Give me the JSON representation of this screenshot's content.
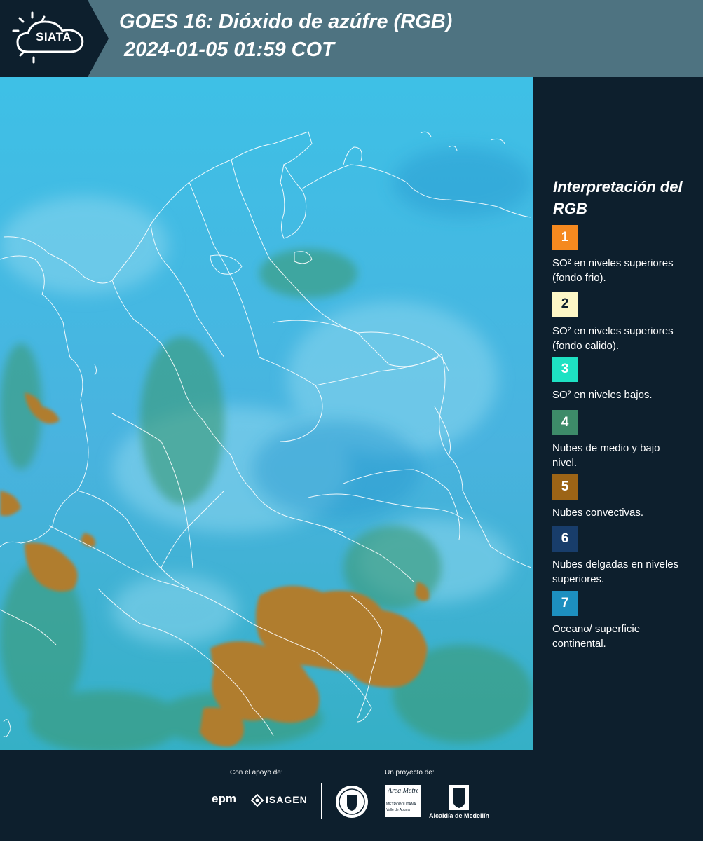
{
  "header": {
    "logo_text": "SIATA",
    "title_line1": "GOES 16: Dióxido de azúfre (RGB)",
    "title_line2": "2024-01-05 01:59 COT"
  },
  "legend": {
    "title": "Interpretación del RGB",
    "items": [
      {
        "number": "1",
        "color": "#f5891f",
        "label": "SO² en niveles superiores (fondo frio)."
      },
      {
        "number": "2",
        "color": "#fdf7c6",
        "label": "SO² en niveles superiores (fondo calido)."
      },
      {
        "number": "3",
        "color": "#1ee1c3",
        "label": "SO² en niveles bajos."
      },
      {
        "number": "4",
        "color": "#3d8b69",
        "label": "Nubes de medio y bajo nivel."
      },
      {
        "number": "5",
        "color": "#9c6416",
        "label": "Nubes convectivas."
      },
      {
        "number": "6",
        "color": "#183d6b",
        "label": "Nubes delgadas en niveles superiores."
      },
      {
        "number": "7",
        "color": "#1d8fbf",
        "label": "Oceano/ superficie continental."
      }
    ]
  },
  "footer": {
    "support_text": "Con el apoyo de:",
    "project_text": "Un proyecto de:",
    "logos": [
      "epm",
      "ISAGEN",
      "Área Metropolitana",
      "Alcaldía de Medellín"
    ],
    "area_sub1": "METROPOLITANA",
    "area_sub2": "Valle de Aburrá"
  }
}
